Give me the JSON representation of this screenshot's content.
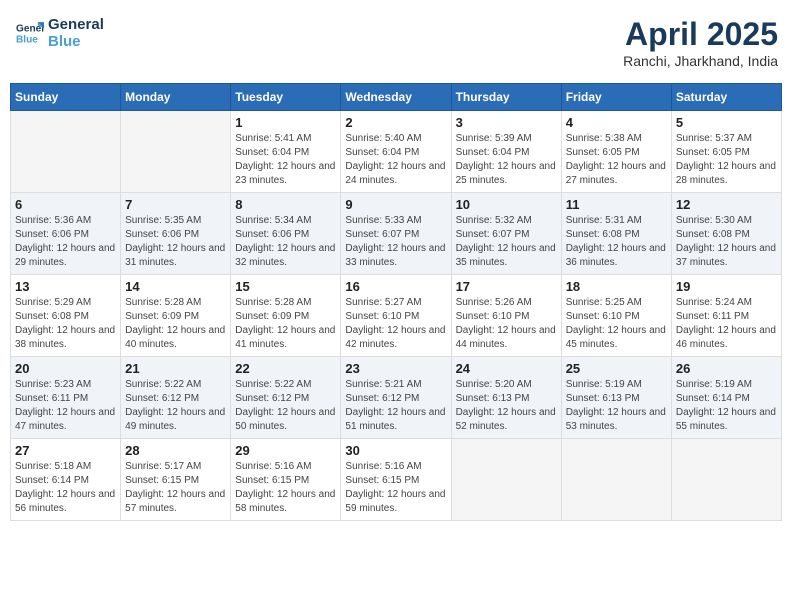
{
  "header": {
    "logo_line1": "General",
    "logo_line2": "Blue",
    "month_title": "April 2025",
    "location": "Ranchi, Jharkhand, India"
  },
  "days_of_week": [
    "Sunday",
    "Monday",
    "Tuesday",
    "Wednesday",
    "Thursday",
    "Friday",
    "Saturday"
  ],
  "weeks": [
    [
      {
        "day": "",
        "sunrise": "",
        "sunset": "",
        "daylight": "",
        "empty": true
      },
      {
        "day": "",
        "sunrise": "",
        "sunset": "",
        "daylight": "",
        "empty": true
      },
      {
        "day": "1",
        "sunrise": "Sunrise: 5:41 AM",
        "sunset": "Sunset: 6:04 PM",
        "daylight": "Daylight: 12 hours and 23 minutes."
      },
      {
        "day": "2",
        "sunrise": "Sunrise: 5:40 AM",
        "sunset": "Sunset: 6:04 PM",
        "daylight": "Daylight: 12 hours and 24 minutes."
      },
      {
        "day": "3",
        "sunrise": "Sunrise: 5:39 AM",
        "sunset": "Sunset: 6:04 PM",
        "daylight": "Daylight: 12 hours and 25 minutes."
      },
      {
        "day": "4",
        "sunrise": "Sunrise: 5:38 AM",
        "sunset": "Sunset: 6:05 PM",
        "daylight": "Daylight: 12 hours and 27 minutes."
      },
      {
        "day": "5",
        "sunrise": "Sunrise: 5:37 AM",
        "sunset": "Sunset: 6:05 PM",
        "daylight": "Daylight: 12 hours and 28 minutes."
      }
    ],
    [
      {
        "day": "6",
        "sunrise": "Sunrise: 5:36 AM",
        "sunset": "Sunset: 6:06 PM",
        "daylight": "Daylight: 12 hours and 29 minutes."
      },
      {
        "day": "7",
        "sunrise": "Sunrise: 5:35 AM",
        "sunset": "Sunset: 6:06 PM",
        "daylight": "Daylight: 12 hours and 31 minutes."
      },
      {
        "day": "8",
        "sunrise": "Sunrise: 5:34 AM",
        "sunset": "Sunset: 6:06 PM",
        "daylight": "Daylight: 12 hours and 32 minutes."
      },
      {
        "day": "9",
        "sunrise": "Sunrise: 5:33 AM",
        "sunset": "Sunset: 6:07 PM",
        "daylight": "Daylight: 12 hours and 33 minutes."
      },
      {
        "day": "10",
        "sunrise": "Sunrise: 5:32 AM",
        "sunset": "Sunset: 6:07 PM",
        "daylight": "Daylight: 12 hours and 35 minutes."
      },
      {
        "day": "11",
        "sunrise": "Sunrise: 5:31 AM",
        "sunset": "Sunset: 6:08 PM",
        "daylight": "Daylight: 12 hours and 36 minutes."
      },
      {
        "day": "12",
        "sunrise": "Sunrise: 5:30 AM",
        "sunset": "Sunset: 6:08 PM",
        "daylight": "Daylight: 12 hours and 37 minutes."
      }
    ],
    [
      {
        "day": "13",
        "sunrise": "Sunrise: 5:29 AM",
        "sunset": "Sunset: 6:08 PM",
        "daylight": "Daylight: 12 hours and 38 minutes."
      },
      {
        "day": "14",
        "sunrise": "Sunrise: 5:28 AM",
        "sunset": "Sunset: 6:09 PM",
        "daylight": "Daylight: 12 hours and 40 minutes."
      },
      {
        "day": "15",
        "sunrise": "Sunrise: 5:28 AM",
        "sunset": "Sunset: 6:09 PM",
        "daylight": "Daylight: 12 hours and 41 minutes."
      },
      {
        "day": "16",
        "sunrise": "Sunrise: 5:27 AM",
        "sunset": "Sunset: 6:10 PM",
        "daylight": "Daylight: 12 hours and 42 minutes."
      },
      {
        "day": "17",
        "sunrise": "Sunrise: 5:26 AM",
        "sunset": "Sunset: 6:10 PM",
        "daylight": "Daylight: 12 hours and 44 minutes."
      },
      {
        "day": "18",
        "sunrise": "Sunrise: 5:25 AM",
        "sunset": "Sunset: 6:10 PM",
        "daylight": "Daylight: 12 hours and 45 minutes."
      },
      {
        "day": "19",
        "sunrise": "Sunrise: 5:24 AM",
        "sunset": "Sunset: 6:11 PM",
        "daylight": "Daylight: 12 hours and 46 minutes."
      }
    ],
    [
      {
        "day": "20",
        "sunrise": "Sunrise: 5:23 AM",
        "sunset": "Sunset: 6:11 PM",
        "daylight": "Daylight: 12 hours and 47 minutes."
      },
      {
        "day": "21",
        "sunrise": "Sunrise: 5:22 AM",
        "sunset": "Sunset: 6:12 PM",
        "daylight": "Daylight: 12 hours and 49 minutes."
      },
      {
        "day": "22",
        "sunrise": "Sunrise: 5:22 AM",
        "sunset": "Sunset: 6:12 PM",
        "daylight": "Daylight: 12 hours and 50 minutes."
      },
      {
        "day": "23",
        "sunrise": "Sunrise: 5:21 AM",
        "sunset": "Sunset: 6:12 PM",
        "daylight": "Daylight: 12 hours and 51 minutes."
      },
      {
        "day": "24",
        "sunrise": "Sunrise: 5:20 AM",
        "sunset": "Sunset: 6:13 PM",
        "daylight": "Daylight: 12 hours and 52 minutes."
      },
      {
        "day": "25",
        "sunrise": "Sunrise: 5:19 AM",
        "sunset": "Sunset: 6:13 PM",
        "daylight": "Daylight: 12 hours and 53 minutes."
      },
      {
        "day": "26",
        "sunrise": "Sunrise: 5:19 AM",
        "sunset": "Sunset: 6:14 PM",
        "daylight": "Daylight: 12 hours and 55 minutes."
      }
    ],
    [
      {
        "day": "27",
        "sunrise": "Sunrise: 5:18 AM",
        "sunset": "Sunset: 6:14 PM",
        "daylight": "Daylight: 12 hours and 56 minutes."
      },
      {
        "day": "28",
        "sunrise": "Sunrise: 5:17 AM",
        "sunset": "Sunset: 6:15 PM",
        "daylight": "Daylight: 12 hours and 57 minutes."
      },
      {
        "day": "29",
        "sunrise": "Sunrise: 5:16 AM",
        "sunset": "Sunset: 6:15 PM",
        "daylight": "Daylight: 12 hours and 58 minutes."
      },
      {
        "day": "30",
        "sunrise": "Sunrise: 5:16 AM",
        "sunset": "Sunset: 6:15 PM",
        "daylight": "Daylight: 12 hours and 59 minutes."
      },
      {
        "day": "",
        "sunrise": "",
        "sunset": "",
        "daylight": "",
        "empty": true
      },
      {
        "day": "",
        "sunrise": "",
        "sunset": "",
        "daylight": "",
        "empty": true
      },
      {
        "day": "",
        "sunrise": "",
        "sunset": "",
        "daylight": "",
        "empty": true
      }
    ]
  ]
}
